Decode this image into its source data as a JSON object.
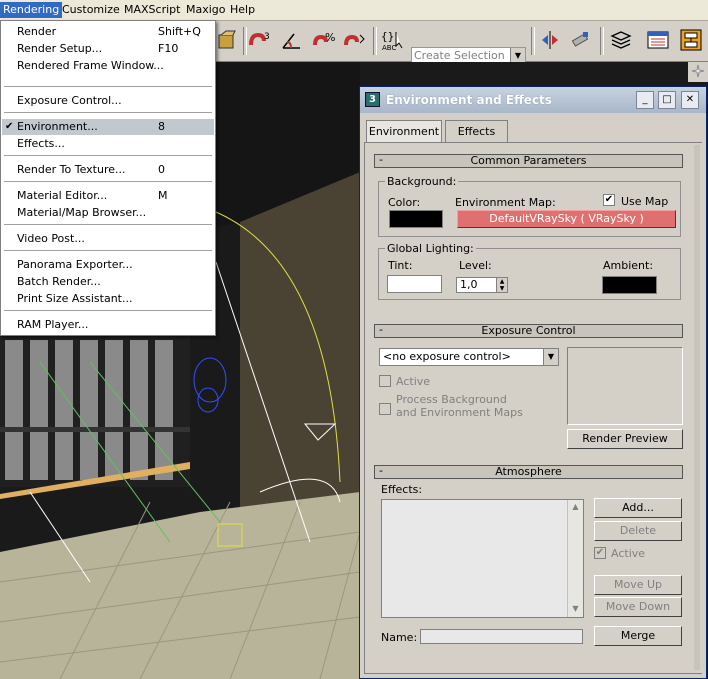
{
  "menubar": {
    "items": [
      "Rendering",
      "Customize",
      "MAXScript",
      "Maxigo",
      "Help"
    ]
  },
  "toolbar": {
    "selection_set_placeholder": "Create Selection Set"
  },
  "rendering_menu": {
    "items": [
      {
        "label": "Render",
        "shortcut": "Shift+Q"
      },
      {
        "label": "Render Setup...",
        "shortcut": "F10"
      },
      {
        "label": "Rendered Frame Window...",
        "shortcut": ""
      },
      {
        "label": "Exposure Control...",
        "shortcut": ""
      },
      {
        "label": "Environment...",
        "shortcut": "8",
        "checked": true,
        "highlighted": true
      },
      {
        "label": "Effects...",
        "shortcut": ""
      },
      {
        "label": "Render To Texture...",
        "shortcut": "0"
      },
      {
        "label": "Material Editor...",
        "shortcut": "M"
      },
      {
        "label": "Material/Map Browser...",
        "shortcut": ""
      },
      {
        "label": "Video Post...",
        "shortcut": ""
      },
      {
        "label": "Panorama Exporter...",
        "shortcut": ""
      },
      {
        "label": "Batch Render...",
        "shortcut": ""
      },
      {
        "label": "Print Size Assistant...",
        "shortcut": ""
      },
      {
        "label": "RAM Player...",
        "shortcut": ""
      }
    ]
  },
  "dialog": {
    "title": "Environment and Effects",
    "tabs": [
      "Environment",
      "Effects"
    ],
    "common": {
      "header": "Common Parameters",
      "minus": "-",
      "background_group": "Background:",
      "color_label": "Color:",
      "color_value": "#000000",
      "env_map_label": "Environment Map:",
      "use_map_label": "Use Map",
      "use_map_checked": true,
      "env_map_button": "DefaultVRaySky  ( VRaySky )",
      "env_map_color": "#e07070",
      "lighting_group": "Global Lighting:",
      "tint_label": "Tint:",
      "tint_value": "#ffffff",
      "level_label": "Level:",
      "level_value": "1,0",
      "ambient_label": "Ambient:",
      "ambient_value": "#000000"
    },
    "exposure": {
      "header": "Exposure Control",
      "minus": "-",
      "dropdown_value": "<no exposure control>",
      "active_label": "Active",
      "process_bg_label_1": "Process Background",
      "process_bg_label_2": "and Environment Maps",
      "render_preview": "Render Preview"
    },
    "atmosphere": {
      "header": "Atmosphere",
      "minus": "-",
      "effects_label": "Effects:",
      "add": "Add...",
      "delete": "Delete",
      "active_label": "Active",
      "move_up": "Move Up",
      "move_down": "Move Down",
      "name_label": "Name:",
      "merge": "Merge"
    }
  }
}
